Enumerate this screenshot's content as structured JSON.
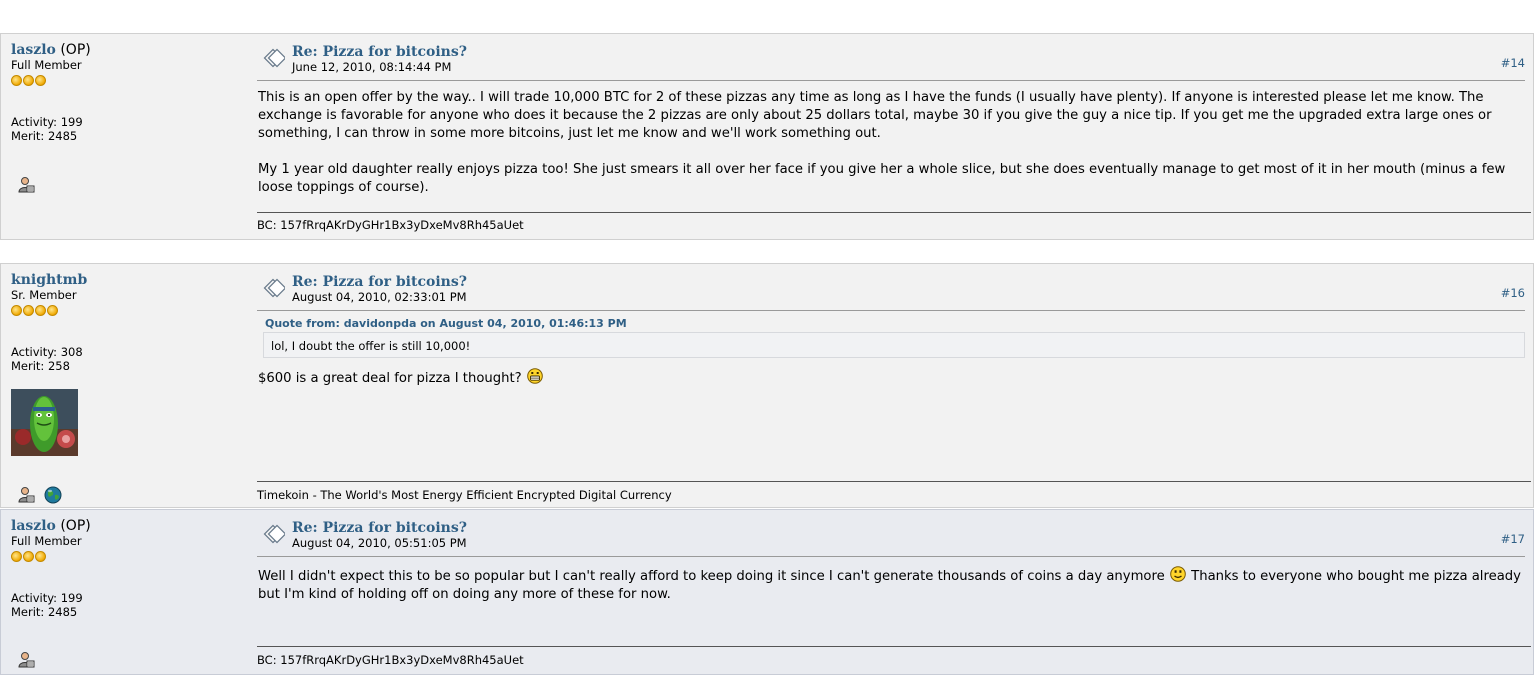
{
  "posts": [
    {
      "username": "laszlo",
      "op_tag": "(OP)",
      "rank": "Full Member",
      "stars": 3,
      "activity": "Activity: 199",
      "merit": "Merit: 2485",
      "subject": "Re: Pizza for bitcoins?",
      "date": "June 12, 2010, 08:14:44 PM",
      "number": "#14",
      "paragraphs": [
        "This is an open offer by the way.. I will trade 10,000 BTC for 2 of these pizzas any time as long as I have the funds (I usually have plenty).  If anyone is interested please let me know.  The exchange is favorable for anyone who does it because the 2 pizzas are only about 25 dollars total, maybe 30 if you give the guy a nice tip.  If you get me the upgraded extra large ones or something, I can throw in some more bitcoins, just let me know and we'll work something out.",
        "My 1 year old daughter really enjoys pizza too!  She just smears it all over her face if you give her a whole slice, but she does eventually manage to get most of it in her mouth (minus a few loose toppings of course)."
      ],
      "signature": "BC: 157fRrqAKrDyGHr1Bx3yDxeMv8Rh45aUet"
    },
    {
      "username": "knightmb",
      "rank": "Sr. Member",
      "stars": 4,
      "activity": "Activity: 308",
      "merit": "Merit: 258",
      "subject": "Re: Pizza for bitcoins?",
      "date": "August 04, 2010, 02:33:01 PM",
      "number": "#16",
      "quote_header": "Quote from: davidonpda on August 04, 2010, 01:46:13 PM",
      "quote_text": "lol, I doubt the offer is still 10,000!",
      "body_text": "$600 is a great deal for pizza I thought?",
      "signature": "Timekoin - The World's Most Energy Efficient Encrypted Digital Currency"
    },
    {
      "username": "laszlo",
      "op_tag": "(OP)",
      "rank": "Full Member",
      "stars": 3,
      "activity": "Activity: 199",
      "merit": "Merit: 2485",
      "subject": "Re: Pizza for bitcoins?",
      "date": "August 04, 2010, 05:51:05 PM",
      "number": "#17",
      "body_before": "Well I didn't expect this to be so popular but I can't really afford to keep doing it since I can't generate thousands of coins a day anymore",
      "body_after": "Thanks to everyone who bought me pizza already but I'm kind of holding off on doing any more of these for now.",
      "signature": "BC: 157fRrqAKrDyGHr1Bx3yDxeMv8Rh45aUet"
    }
  ],
  "icons": {
    "post_icon": "xx-post-icon",
    "profile": "profile-icon",
    "website": "globe-icon",
    "smiley_grin": "grin-smiley-icon",
    "smiley_smile": "smile-smiley-icon"
  },
  "colors": {
    "link": "#2f5f85",
    "star": "#f0a800"
  }
}
